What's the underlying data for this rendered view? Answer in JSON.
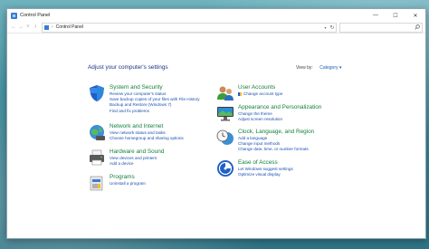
{
  "window": {
    "title": "Control Panel",
    "controls": {
      "minimize": "—",
      "maximize": "☐",
      "close": "✕"
    }
  },
  "addressbar": {
    "back": "←",
    "forward": "→",
    "recent": "˅",
    "up": "↑",
    "separator": "›",
    "path": "Control Panel",
    "dropdown": "▾",
    "refresh": "↻",
    "search_placeholder": ""
  },
  "main": {
    "heading": "Adjust your computer's settings",
    "view_by_label": "View by:",
    "view_by_value": "Category ▾"
  },
  "categories": [
    {
      "id": "system-security",
      "icon": "shield-icon",
      "title": "System and Security",
      "links": [
        "Review your computer's status",
        "Save backup copies of your files with File History",
        "Backup and Restore (Windows 7)",
        "Find and fix problems"
      ]
    },
    {
      "id": "network-internet",
      "icon": "globe-network-icon",
      "title": "Network and Internet",
      "links": [
        "View network status and tasks",
        "Choose homegroup and sharing options"
      ]
    },
    {
      "id": "hardware-sound",
      "icon": "printer-icon",
      "title": "Hardware and Sound",
      "links": [
        "View devices and printers",
        "Add a device"
      ]
    },
    {
      "id": "programs",
      "icon": "programs-icon",
      "title": "Programs",
      "links": [
        "Uninstall a program"
      ]
    },
    {
      "id": "user-accounts",
      "icon": "users-icon",
      "title": "User Accounts",
      "links": [
        "Change account type"
      ]
    },
    {
      "id": "appearance",
      "icon": "display-icon",
      "title": "Appearance and Personalization",
      "links": [
        "Change the theme",
        "Adjust screen resolution"
      ]
    },
    {
      "id": "clock-region",
      "icon": "clock-globe-icon",
      "title": "Clock, Language, and Region",
      "links": [
        "Add a language",
        "Change input methods",
        "Change date, time, or number formats"
      ]
    },
    {
      "id": "ease-access",
      "icon": "ease-of-access-icon",
      "title": "Ease of Access",
      "links": [
        "Let Windows suggest settings",
        "Optimize visual display"
      ]
    }
  ]
}
